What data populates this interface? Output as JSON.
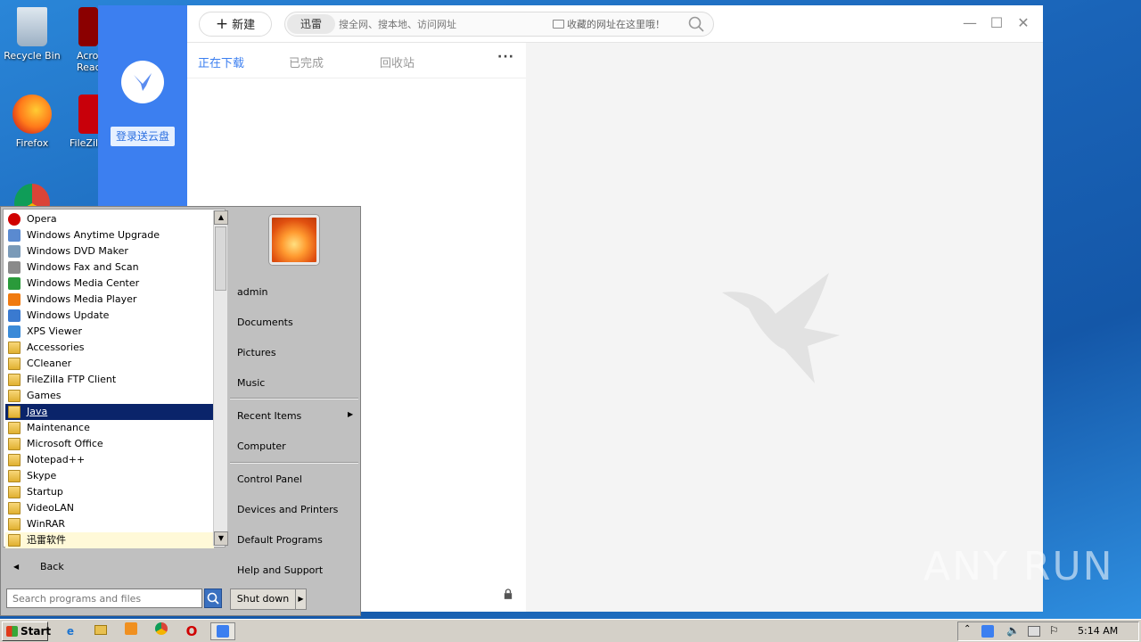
{
  "desktop": {
    "icons": [
      {
        "label": "Recycle Bin"
      },
      {
        "label": "Acro Read"
      },
      {
        "label": "Firefox"
      },
      {
        "label": "FileZilla"
      }
    ]
  },
  "xunlei": {
    "login_label": "登录送云盘",
    "new_button": "新建",
    "search_source": "迅雷",
    "search_placeholder": "搜全网、搜本地、访问网址",
    "favorites_hint": "收藏的网址在这里哦！",
    "tabs": [
      "正在下载",
      "已完成",
      "回收站"
    ],
    "more": "···"
  },
  "start_menu": {
    "programs": [
      {
        "label": "Opera",
        "icon": "opera-icon"
      },
      {
        "label": "Windows Anytime Upgrade",
        "icon": "windows-upgrade-icon"
      },
      {
        "label": "Windows DVD Maker",
        "icon": "dvd-maker-icon"
      },
      {
        "label": "Windows Fax and Scan",
        "icon": "fax-scan-icon"
      },
      {
        "label": "Windows Media Center",
        "icon": "media-center-icon"
      },
      {
        "label": "Windows Media Player",
        "icon": "media-player-icon"
      },
      {
        "label": "Windows Update",
        "icon": "windows-update-icon"
      },
      {
        "label": "XPS Viewer",
        "icon": "xps-viewer-icon"
      },
      {
        "label": "Accessories",
        "icon": "folder-icon"
      },
      {
        "label": "CCleaner",
        "icon": "folder-icon"
      },
      {
        "label": "FileZilla FTP Client",
        "icon": "folder-icon"
      },
      {
        "label": "Games",
        "icon": "folder-icon"
      },
      {
        "label": "Java",
        "icon": "folder-icon"
      },
      {
        "label": "Maintenance",
        "icon": "folder-icon"
      },
      {
        "label": "Microsoft Office",
        "icon": "folder-icon"
      },
      {
        "label": "Notepad++",
        "icon": "folder-icon"
      },
      {
        "label": "Skype",
        "icon": "folder-icon"
      },
      {
        "label": "Startup",
        "icon": "folder-icon"
      },
      {
        "label": "VideoLAN",
        "icon": "folder-icon"
      },
      {
        "label": "WinRAR",
        "icon": "folder-icon"
      },
      {
        "label": "迅雷软件",
        "icon": "folder-icon"
      }
    ],
    "selected_program": "Java",
    "back_label": "Back",
    "search_placeholder": "Search programs and files",
    "right_items": [
      "admin",
      "Documents",
      "Pictures",
      "Music",
      "Recent Items",
      "Computer",
      "Control Panel",
      "Devices and Printers",
      "Default Programs",
      "Help and Support"
    ],
    "shutdown_label": "Shut down"
  },
  "taskbar": {
    "start_label": "Start",
    "clock": "5:14 AM"
  },
  "watermark": "ANY RUN"
}
